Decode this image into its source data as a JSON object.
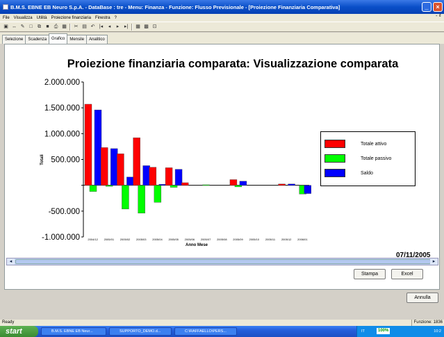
{
  "window": {
    "title": "B.M.S. EBNE EB Neuro S.p.A. - DataBase : tre - Menu: Finanza - Funzione: Flusso Previsionale - [Proiezione Finanziaria Comparativa]"
  },
  "menu": {
    "items": [
      "File",
      "Visualizza",
      "Utilità",
      "Proiezione finanziaria",
      "Finestra",
      "?"
    ],
    "right": "- ₫"
  },
  "tabs": [
    {
      "label": "Selezione"
    },
    {
      "label": "Scadenza"
    },
    {
      "label": "Grafico"
    },
    {
      "label": "Mensile"
    },
    {
      "label": "Analitico"
    }
  ],
  "toolbar": {
    "icons": [
      "document-icon",
      "arrow-icon",
      "tools-icon",
      "new-icon",
      "copy-icon",
      "save-icon",
      "print-icon",
      "preview-icon",
      "cut-icon",
      "paste-icon",
      "undo-icon",
      "first-icon",
      "prev-icon",
      "next-icon",
      "last-icon",
      "grid-icon",
      "find-icon",
      "filter-icon"
    ]
  },
  "chart_data": {
    "type": "bar",
    "title": "Proiezione finanziaria comparata: Visualizzazione comparata",
    "ylabel": "Totali",
    "xlabel": "Anno Mese",
    "ylim": [
      -1000000,
      2000000
    ],
    "yticks": [
      "2.000.000",
      "1.500.000",
      "1.000.000",
      "500.000",
      "",
      "-500.000",
      "-1.000.000"
    ],
    "ytick_values": [
      2000000,
      1500000,
      1000000,
      500000,
      0,
      -500000,
      -1000000
    ],
    "categories": [
      "2004/12",
      "2005/01",
      "2005/02",
      "2005/03",
      "2005/04",
      "2005/05",
      "2005/06",
      "2005/07",
      "2005/08",
      "2005/09",
      "2005/10",
      "2005/11",
      "2005/12",
      "2006/01"
    ],
    "series": [
      {
        "name": "Totale attivo",
        "color": "#ff0000",
        "values": [
          1570000,
          730000,
          610000,
          920000,
          350000,
          340000,
          50000,
          0,
          0,
          110000,
          0,
          0,
          25000,
          0
        ]
      },
      {
        "name": "Totale passivo",
        "color": "#00ff00",
        "values": [
          -120000,
          -20000,
          -460000,
          -540000,
          -330000,
          -40000,
          0,
          10000,
          0,
          -30000,
          0,
          0,
          0,
          -170000
        ]
      },
      {
        "name": "Saldo",
        "color": "#0000ff",
        "values": [
          1460000,
          710000,
          160000,
          380000,
          20000,
          310000,
          0,
          0,
          0,
          80000,
          0,
          0,
          25000,
          -160000
        ]
      }
    ],
    "legend_position": "right",
    "grid": false
  },
  "report_date": "07/11/2005",
  "buttons": {
    "print": "Stampa",
    "excel": "Excel",
    "cancel": "Annulla"
  },
  "status": {
    "left": "Ready",
    "right": "Funzione: 1836"
  },
  "taskbar": {
    "start": "start",
    "tasks": [
      "B.M.S. EBNE EB Neur...",
      "SUPPORTO_DEMO.d...",
      "C:\\RAFFAELLO\\PERS..."
    ],
    "lang": "IT",
    "zoom": "100%",
    "clock": "10:2"
  }
}
